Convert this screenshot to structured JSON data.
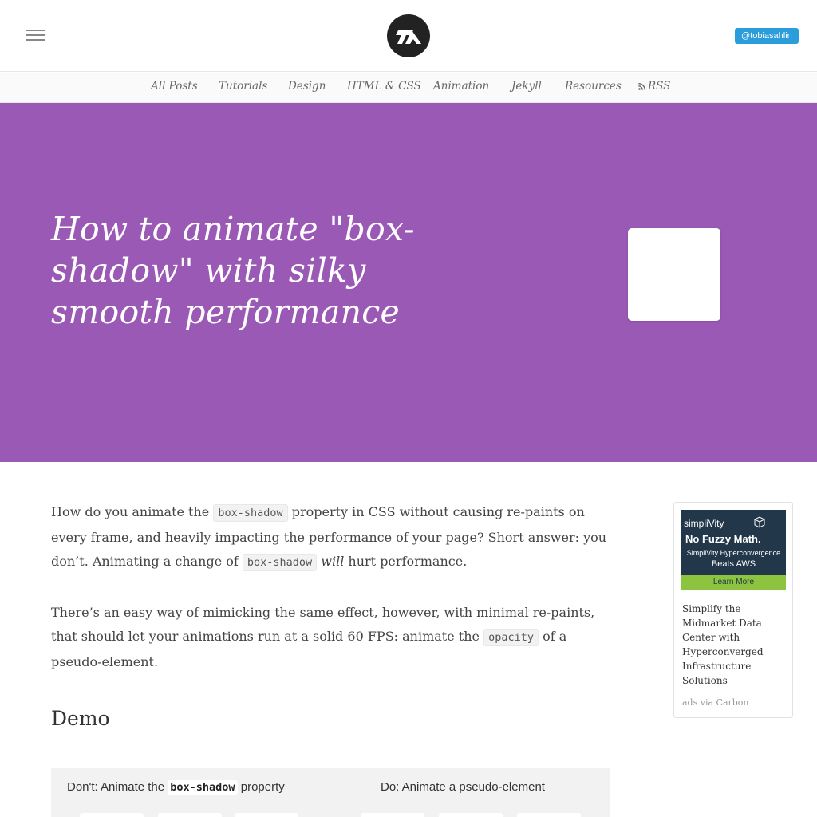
{
  "header": {
    "twitter_handle": "@tobiasahlin"
  },
  "nav": {
    "items": [
      "All Posts",
      "Tutorials",
      "Design",
      "HTML & CSS",
      "Animation",
      "Jekyll",
      "Resources",
      "RSS"
    ]
  },
  "hero": {
    "title": "How to animate \"box-shadow\" with silky smooth performance",
    "background_color": "#9b59b6"
  },
  "article": {
    "p1_a": "How do you animate the ",
    "p1_code1": "box-shadow",
    "p1_b": " property in CSS without causing re-paints on every frame, and heavily impacting the performance of your page? Short answer: you don’t. Animating a change of ",
    "p1_code2": "box-shadow",
    "p1_em": "will",
    "p1_c": " hurt performance.",
    "p2_a": "There’s an easy way of mimicking the same effect, however, with minimal re-paints, that should let your animations run at a solid 60 FPS: animate the ",
    "p2_code": "opacity",
    "p2_b": " of a pseudo-element.",
    "demo_heading": "Demo",
    "demo_dont_a": "Don't: Animate the ",
    "demo_dont_code": "box-shadow",
    "demo_dont_b": " property",
    "demo_do": "Do: Animate a pseudo-element"
  },
  "ad": {
    "brand": "simpliVity",
    "headline": "No Fuzzy Math.",
    "sub": "SimpliVity Hyperconvergence",
    "sub2": "Beats AWS",
    "cta": "Learn More",
    "text": "Simplify the Midmarket Data Center with Hyperconverged Infrastructure Solutions",
    "via": "ads via Carbon"
  },
  "icons": {
    "menu": "hamburger-menu-icon",
    "logo": "ta-logo-icon",
    "rss": "rss-icon"
  }
}
